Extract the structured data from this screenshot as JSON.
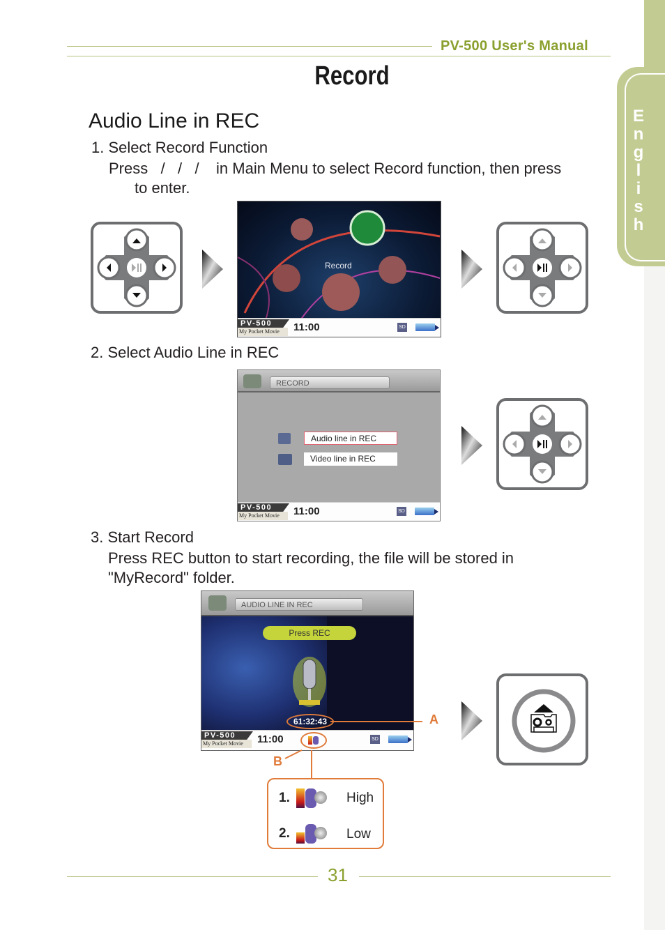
{
  "header": {
    "manual_title": "PV-500 User's Manual",
    "page_title": "Record"
  },
  "side_tab": {
    "label": "English",
    "letters": [
      "E",
      "n",
      "g",
      "l",
      "i",
      "s",
      "h"
    ]
  },
  "section": {
    "heading": "Audio Line in REC",
    "steps": [
      {
        "title": "1. Select Record Function",
        "body_line1": "Press   /   /   /    in Main Menu to select Record function, then press",
        "body_line2": "to enter."
      },
      {
        "title": "2. Select Audio Line in REC"
      },
      {
        "title": "3. Start Record",
        "body_line1": "Press REC button to start recording, the file will be stored in",
        "body_line2": "\"MyRecord\" folder."
      }
    ]
  },
  "screens": {
    "main_menu": {
      "focus_label": "Record",
      "status": {
        "brand": "PV-500",
        "sub": "My Pocket Movie",
        "time": "11:00",
        "sd": "SD"
      }
    },
    "record_menu": {
      "title": "RECORD",
      "options": [
        "Audio line in REC",
        "Video line in REC"
      ],
      "selected_index": 0,
      "status": {
        "brand": "PV-500",
        "sub": "My Pocket Movie",
        "time": "11:00",
        "sd": "SD"
      }
    },
    "audio_rec": {
      "title": "AUDIO LINE IN REC",
      "prompt": "Press REC",
      "timer": "61:32:43",
      "status": {
        "brand": "PV-500",
        "sub": "My Pocket Movie",
        "time": "11:00",
        "sd": "SD"
      }
    }
  },
  "callouts": {
    "a_label": "A",
    "b_label": "B",
    "quality_options": [
      {
        "num": "1.",
        "label": "High"
      },
      {
        "num": "2.",
        "label": "Low"
      }
    ]
  },
  "colors": {
    "accent_green": "#8aa02e",
    "tab_green": "#c2cc92",
    "callout_orange": "#e07b3a"
  },
  "footer": {
    "page_number": "31"
  }
}
